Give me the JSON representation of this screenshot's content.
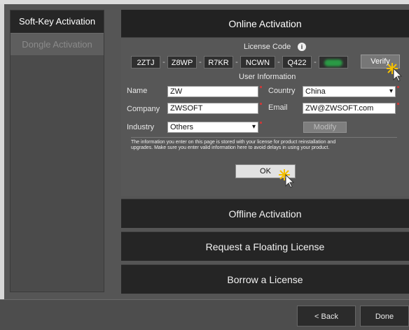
{
  "sidebar": {
    "items": [
      {
        "label": "Soft-Key Activation"
      },
      {
        "label": "Dongle Activation"
      }
    ]
  },
  "online": {
    "title": "Online Activation",
    "license_code_label": "License Code",
    "codes": [
      "2ZTJ",
      "Z8WP",
      "R7KR",
      "NCWN",
      "Q422"
    ],
    "verify_label": "Verify",
    "user_info_label": "User Information",
    "name_label": "Name",
    "name_value": "ZW",
    "country_label": "Country",
    "country_value": "China",
    "company_label": "Company",
    "company_value": "ZWSOFT",
    "email_label": "Email",
    "email_value": "ZW@ZWSOFT.com",
    "industry_label": "Industry",
    "industry_value": "Others",
    "modify_label": "Modify",
    "notice_line1": "The information you enter on this page is stored with your license for product reinstallation and",
    "notice_line2": "upgrades. Make sure you enter valid information here to avoid delays in using your product.",
    "ok_label": "OK"
  },
  "sections": {
    "offline": "Offline Activation",
    "floating": "Request a Floating License",
    "borrow": "Borrow a License"
  },
  "footer": {
    "back_label": "< Back",
    "done_label": "Done"
  },
  "colors": {
    "background": "#555555",
    "header": "#222222",
    "active_tab": "#262626",
    "highlight": "#f5c000"
  }
}
